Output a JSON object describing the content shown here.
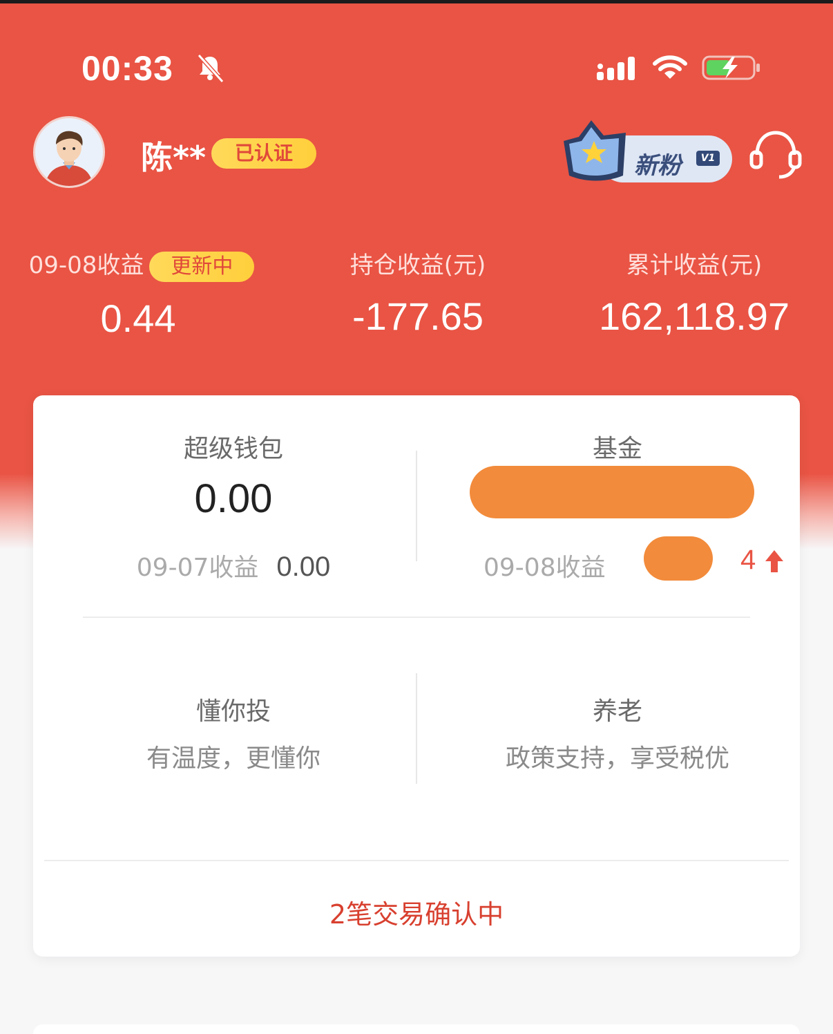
{
  "status_bar": {
    "time": "00:33",
    "icons": [
      "bell-muted-icon",
      "signal-icon",
      "wifi-icon",
      "battery-charging-icon"
    ]
  },
  "profile": {
    "name": "陈**",
    "verified_label": "已认证",
    "level_label": "新粉",
    "level_tag": "V1"
  },
  "earnings": {
    "daily_label": "09-08收益",
    "daily_status": "更新中",
    "daily_value": "0.44",
    "holding_label": "持仓收益(元)",
    "holding_value": "-177.65",
    "cumulative_label": "累计收益(元)",
    "cumulative_value": "162,118.97"
  },
  "assets": {
    "wallet_title": "超级钱包",
    "wallet_value": "0.00",
    "wallet_sub_label": "09-07收益",
    "wallet_sub_value": "0.00",
    "fund_title": "基金",
    "fund_sub_label": "09-08收益",
    "fund_sub_visible_digit": "4"
  },
  "features": {
    "invest_title": "懂你投",
    "invest_desc": "有温度，更懂你",
    "pension_title": "养老",
    "pension_desc": "政策支持，享受税优"
  },
  "pending": {
    "label": "2笔交易确认中"
  },
  "colors": {
    "header_red": "#e95444",
    "badge_yellow": "#ffd95a",
    "redaction_orange": "#f28b3b",
    "pending_red": "#d8402f"
  }
}
